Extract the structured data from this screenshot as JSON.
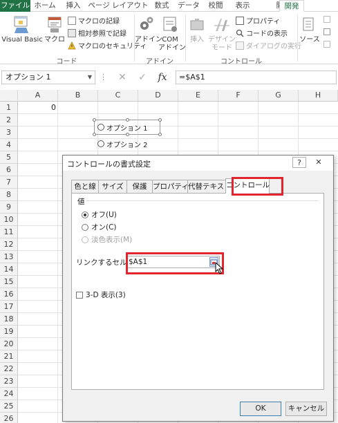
{
  "ribbon_tabs": [
    "ファイル",
    "ホーム",
    "挿入",
    "ページ レイアウト",
    "数式",
    "データ",
    "校閲",
    "表示",
    "開発"
  ],
  "ribbon": {
    "code_group": {
      "label": "コード",
      "visual_basic": "Visual Basic",
      "macro": "マクロ",
      "record_macro": "マクロの記録",
      "relative_ref": "相対参照で記録",
      "macro_security": "マクロのセキュリティ"
    },
    "addin_group": {
      "label": "アドイン",
      "addin": "アドイン",
      "com_addin_1": "COM",
      "com_addin_2": "アドイン"
    },
    "controls_group": {
      "label": "コントロール",
      "insert": "挿入",
      "design_mode_1": "デザイン",
      "design_mode_2": "モード",
      "properties": "プロパティ",
      "view_code": "コードの表示",
      "run_dialog": "ダイアログの実行"
    },
    "source_group": {
      "source": "ソース"
    }
  },
  "formula_bar": {
    "name_box": "オプション 1",
    "cancel_icon": "✕",
    "enter_icon": "✓",
    "fx_icon": "fx",
    "formula": "=$A$1"
  },
  "sheet": {
    "columns": [
      "A",
      "B",
      "C",
      "D",
      "E",
      "F",
      "G",
      "H"
    ],
    "rows": [
      "1",
      "2",
      "3",
      "4",
      "5",
      "6",
      "7",
      "8",
      "9",
      "10",
      "11",
      "12",
      "13",
      "14",
      "15",
      "16",
      "17",
      "18",
      "19",
      "20",
      "21",
      "22",
      "23",
      "24",
      "25",
      "26"
    ],
    "cell_a1": "0",
    "option1": "オプション 1",
    "option2": "オプション 2"
  },
  "dialog": {
    "title": "コントロールの書式設定",
    "help": "?",
    "close": "✕",
    "tabs": [
      "色と線",
      "サイズ",
      "保護",
      "プロパティ",
      "代替テキスト",
      "コントロール"
    ],
    "selected_tab": "コントロール",
    "value_label": "値",
    "off_option": "オフ(U)",
    "on_option": "オン(C)",
    "mixed_option": "淡色表示(M)",
    "link_label": "リンクするセル(L):",
    "link_value": "$A$1",
    "shading_3d": "3-D 表示(3)",
    "ok": "OK",
    "cancel": "キャンセル"
  },
  "colors": {
    "file_tab": "#217346",
    "highlight": "#e1252f"
  }
}
